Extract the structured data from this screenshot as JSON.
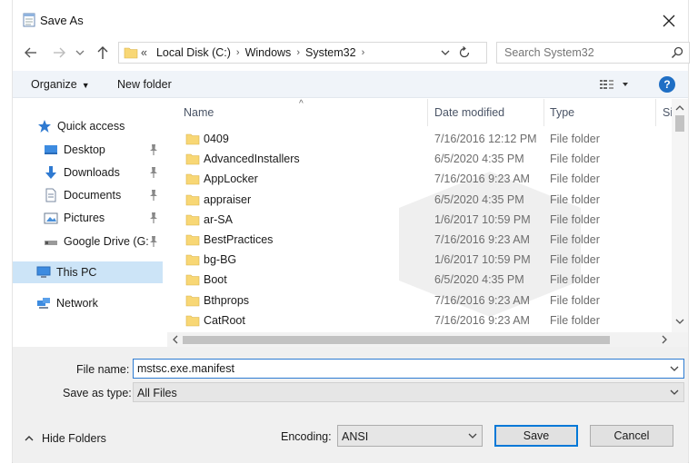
{
  "window": {
    "title": "Save As"
  },
  "address": {
    "crumbs": [
      {
        "label": "«"
      },
      {
        "label": "Local Disk (C:)"
      },
      {
        "label": "Windows"
      },
      {
        "label": "System32"
      }
    ]
  },
  "search": {
    "placeholder": "Search System32"
  },
  "toolbar": {
    "organize_label": "Organize",
    "new_folder_label": "New folder",
    "help_label": "?"
  },
  "nav": {
    "items": [
      {
        "label": "Quick access",
        "icon": "star-icon"
      },
      {
        "label": "Desktop",
        "icon": "desktop-icon",
        "pinned": true
      },
      {
        "label": "Downloads",
        "icon": "download-arrow-icon",
        "pinned": true
      },
      {
        "label": "Documents",
        "icon": "document-icon",
        "pinned": true
      },
      {
        "label": "Pictures",
        "icon": "pictures-icon",
        "pinned": true
      },
      {
        "label": "Google Drive (G:",
        "icon": "drive-icon",
        "pinned": true
      },
      {
        "label": "This PC",
        "icon": "computer-icon",
        "selected": true
      },
      {
        "label": "Network",
        "icon": "network-icon"
      }
    ]
  },
  "list": {
    "columns": {
      "name": "Name",
      "date": "Date modified",
      "type": "Type",
      "size": "Si"
    },
    "rows": [
      {
        "name": "0409",
        "date": "7/16/2016 12:12 PM",
        "type": "File folder"
      },
      {
        "name": "AdvancedInstallers",
        "date": "6/5/2020 4:35 PM",
        "type": "File folder"
      },
      {
        "name": "AppLocker",
        "date": "7/16/2016 9:23 AM",
        "type": "File folder"
      },
      {
        "name": "appraiser",
        "date": "6/5/2020 4:35 PM",
        "type": "File folder"
      },
      {
        "name": "ar-SA",
        "date": "1/6/2017 10:59 PM",
        "type": "File folder"
      },
      {
        "name": "BestPractices",
        "date": "7/16/2016 9:23 AM",
        "type": "File folder"
      },
      {
        "name": "bg-BG",
        "date": "1/6/2017 10:59 PM",
        "type": "File folder"
      },
      {
        "name": "Boot",
        "date": "6/5/2020 4:35 PM",
        "type": "File folder"
      },
      {
        "name": "Bthprops",
        "date": "7/16/2016 9:23 AM",
        "type": "File folder"
      },
      {
        "name": "CatRoot",
        "date": "7/16/2016 9:23 AM",
        "type": "File folder"
      }
    ]
  },
  "form": {
    "file_name_label": "File name:",
    "file_name_value": "mstsc.exe.manifest",
    "save_as_type_label": "Save as type:",
    "save_as_type_value": "All Files",
    "encoding_label": "Encoding:",
    "encoding_value": "ANSI",
    "hide_folders_label": "Hide Folders",
    "save_label": "Save",
    "cancel_label": "Cancel"
  },
  "colors": {
    "accent": "#0078d7",
    "selection": "#cce4f7",
    "folder": "#f8d775",
    "toolbar_bg": "#f0f4f9"
  }
}
